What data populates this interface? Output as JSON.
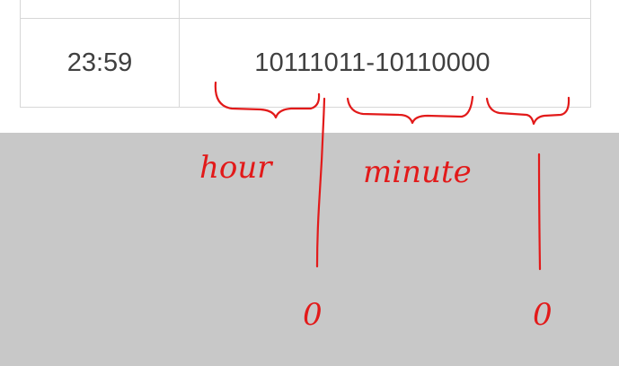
{
  "table": {
    "time_value": "23:59",
    "binary_value": "10111011-10110000"
  },
  "annotations": {
    "hour_label": "hour",
    "minute_label": "minute",
    "zero_left": "0",
    "zero_right": "0",
    "ink_color": "#e21a1a"
  }
}
